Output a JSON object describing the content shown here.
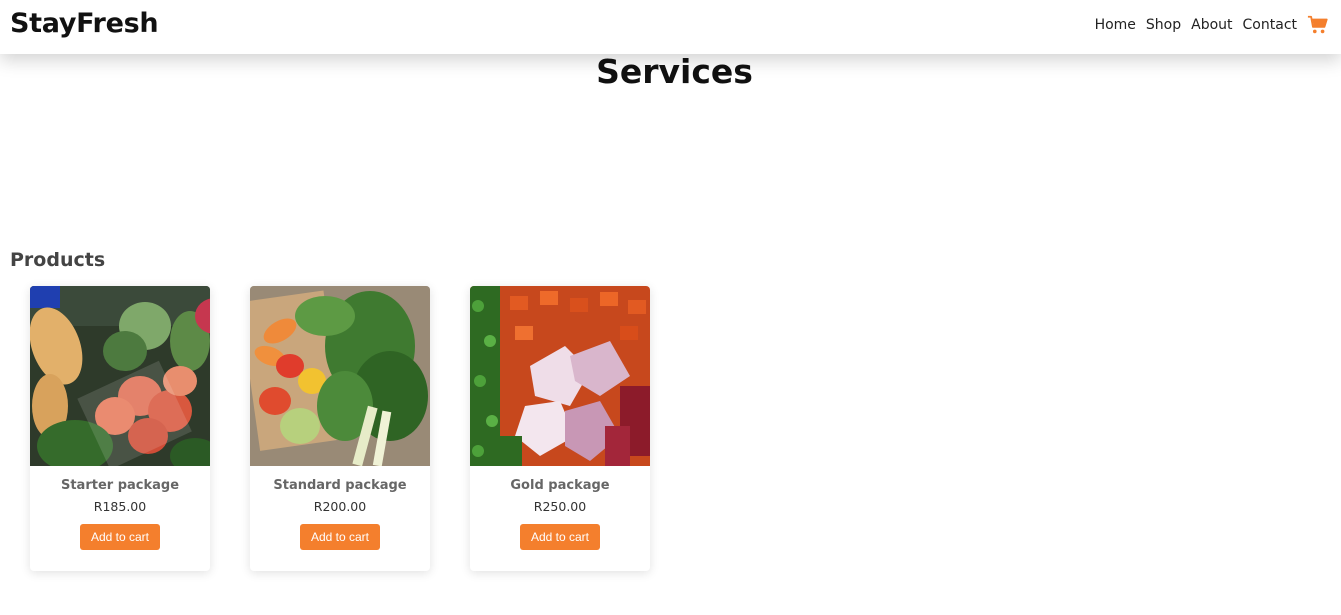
{
  "navbar": {
    "logo": "StayFresh",
    "links": [
      "Home",
      "Shop",
      "About",
      "Contact"
    ],
    "cart_icon": "shopping-cart-icon",
    "cart_color": "#f47f2d"
  },
  "page": {
    "title": "Services",
    "products_heading": "Products"
  },
  "products": [
    {
      "name": "Starter package",
      "price": "R185.00",
      "button": "Add to cart",
      "image": "vegetables-in-crate-photo"
    },
    {
      "name": "Standard package",
      "price": "R200.00",
      "button": "Add to cart",
      "image": "greens-box-photo"
    },
    {
      "name": "Gold package",
      "price": "R250.00",
      "button": "Add to cart",
      "image": "chopped-vegetables-photo"
    }
  ],
  "colors": {
    "accent": "#f47f2d"
  }
}
